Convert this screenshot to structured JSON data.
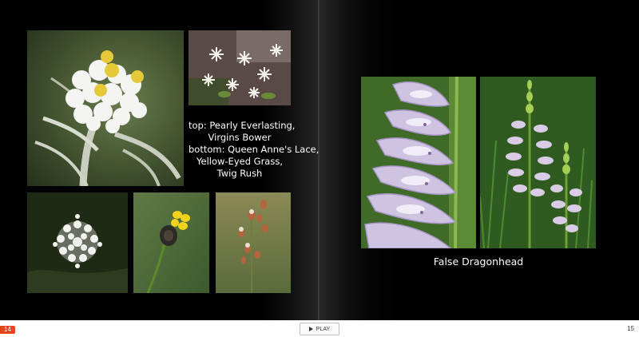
{
  "caption": {
    "lines": [
      "top: Pearly Everlasting,",
      "Virgins Bower",
      "bottom: Queen Anne's Lace,",
      "Yellow-Eyed Grass,",
      "Twig Rush"
    ]
  },
  "right_page": {
    "title": "False Dragonhead"
  },
  "controls": {
    "play_label": "PLAY"
  },
  "pages": {
    "left": "14",
    "right": "15"
  },
  "colors": {
    "page_badge": "#e8441e",
    "page_background": "#000000"
  }
}
